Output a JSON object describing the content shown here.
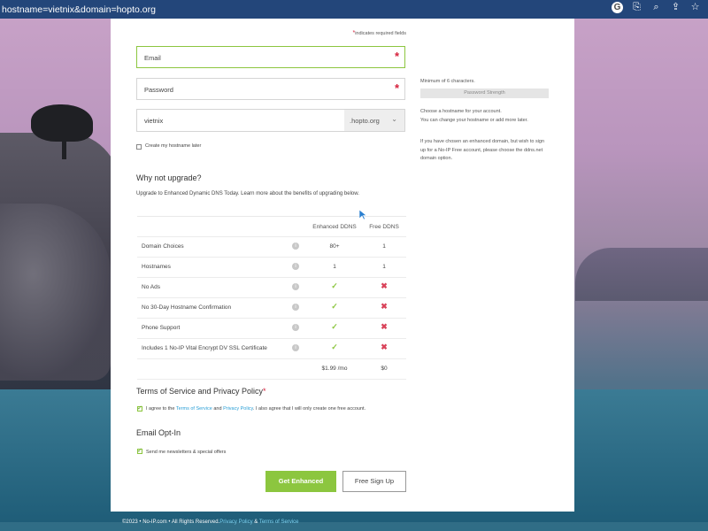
{
  "browser": {
    "url": "hostname=vietnix&domain=hopto.org",
    "icons": [
      "google-icon",
      "translate-icon",
      "zoom-icon",
      "share-icon",
      "bookmark-star-icon"
    ]
  },
  "form": {
    "required_note": "indicates required fields",
    "email_placeholder": "Email",
    "password_placeholder": "Password",
    "hostname_value": "vietnix",
    "domain_value": ".hopto.org",
    "create_later_label": "Create my hostname later"
  },
  "side": {
    "min_chars": "Minimum of 6 characters.",
    "password_strength": "Password Strength",
    "hostname_help_1": "Choose a hostname for your account.",
    "hostname_help_2": "You can change your hostname or add more later.",
    "enhanced_help_1": "If you have chosen an enhanced domain, but wish to sign",
    "enhanced_help_2": "up for a No-IP Free account, please choose the ddns.net",
    "enhanced_help_3": "domain option."
  },
  "upgrade": {
    "title": "Why not upgrade?",
    "description": "Upgrade to Enhanced Dynamic DNS Today. Learn more about the benefits of upgrading below.",
    "col_enhanced": "Enhanced DDNS",
    "col_free": "Free DDNS",
    "rows": [
      {
        "feature": "Domain Choices",
        "enhanced": "80+",
        "free": "1"
      },
      {
        "feature": "Hostnames",
        "enhanced": "1",
        "free": "1"
      },
      {
        "feature": "No Ads",
        "enhanced": "✓",
        "free": "✖"
      },
      {
        "feature": "No 30-Day Hostname Confirmation",
        "enhanced": "✓",
        "free": "✖"
      },
      {
        "feature": "Phone Support",
        "enhanced": "✓",
        "free": "✖"
      },
      {
        "feature": "Includes 1 No-IP Vital Encrypt DV SSL Certificate",
        "enhanced": "✓",
        "free": "✖"
      }
    ],
    "price_enhanced": "$1.99 /mo",
    "price_free": "$0"
  },
  "terms": {
    "title": "Terms of Service and Privacy Policy",
    "agree_prefix": "I agree to the",
    "terms_link": "Terms of Service",
    "and": "and",
    "privacy_link": "Privacy Policy",
    "agree_suffix": ". I also agree that I will only create one free account."
  },
  "optin": {
    "title": "Email Opt-In",
    "label": "Send me newsletters & special offers"
  },
  "buttons": {
    "enhanced": "Get Enhanced",
    "free": "Free Sign Up"
  },
  "footer": {
    "text": "©2023 • No-IP.com • All Rights Reserved.",
    "privacy": "Privacy Policy",
    "amp": "&",
    "terms": "Terms of Service"
  }
}
